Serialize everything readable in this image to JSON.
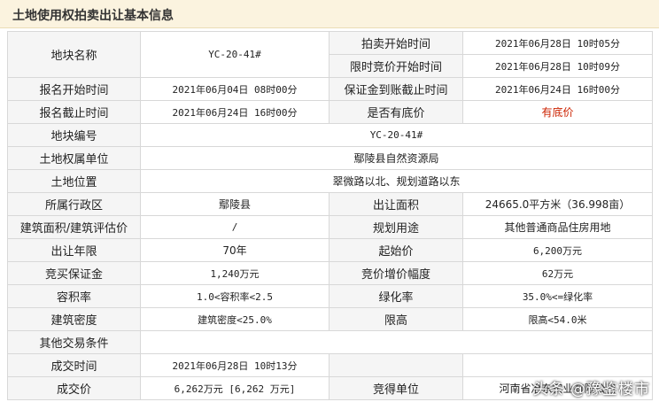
{
  "header": {
    "title": "土地使用权拍卖出让基本信息"
  },
  "rows": {
    "parcel_name": {
      "label": "地块名称",
      "value": "YC-20-41#"
    },
    "auction_start": {
      "label": "拍卖开始时间",
      "value": "2021年06月28日 10时05分"
    },
    "limited_bid_start": {
      "label": "限时竞价开始时间",
      "value": "2021年06月28日 10时09分"
    },
    "reg_start": {
      "label": "报名开始时间",
      "value": "2021年06月04日 08时00分"
    },
    "deposit_deadline": {
      "label": "保证金到账截止时间",
      "value": "2021年06月24日 16时00分"
    },
    "reg_end": {
      "label": "报名截止时间",
      "value": "2021年06月24日 16时00分"
    },
    "reserve_price": {
      "label": "是否有底价",
      "value": "有底价",
      "value_color": "#cc2200"
    },
    "parcel_number": {
      "label": "地块编号",
      "value": "YC-20-41#"
    },
    "ownership_unit": {
      "label": "土地权属单位",
      "value": "鄢陵县自然资源局"
    },
    "location": {
      "label": "土地位置",
      "value": "翠微路以北、规划道路以东"
    },
    "district": {
      "label": "所属行政区",
      "value": "鄢陵县"
    },
    "area": {
      "label": "出让面积",
      "value": "24665.0平方米（36.998亩）"
    },
    "building_area": {
      "label": "建筑面积/建筑评估价",
      "value": "/"
    },
    "planned_use": {
      "label": "规划用途",
      "value": "其他普通商品住房用地"
    },
    "term": {
      "label": "出让年限",
      "value": "70年"
    },
    "start_price": {
      "label": "起始价",
      "value": "6,200万元"
    },
    "bid_deposit": {
      "label": "竞买保证金",
      "value": "1,240万元"
    },
    "increment": {
      "label": "竞价增价幅度",
      "value": "62万元"
    },
    "far": {
      "label": "容积率",
      "value": "1.0<容积率<2.5"
    },
    "green_rate": {
      "label": "绿化率",
      "value": "35.0%<=绿化率"
    },
    "density": {
      "label": "建筑密度",
      "value": "建筑密度<25.0%"
    },
    "height_limit": {
      "label": "限高",
      "value": "限高<54.0米"
    },
    "other_conditions": {
      "label": "其他交易条件",
      "value": ""
    },
    "deal_time": {
      "label": "成交时间",
      "value": "2021年06月28日 10时13分"
    },
    "deal_price": {
      "label": "成交价",
      "value": "6,262万元 [6,262 万元]"
    },
    "winner": {
      "label": "竞得单位",
      "value": "河南省冶东实业有限公司"
    }
  },
  "watermark": "头条 @豫鉴楼市",
  "colors": {
    "header_bg": "#fbf3df",
    "label_bg": "#f5f5f5",
    "border": "#d8d8d8",
    "accent_red": "#cc2200"
  }
}
